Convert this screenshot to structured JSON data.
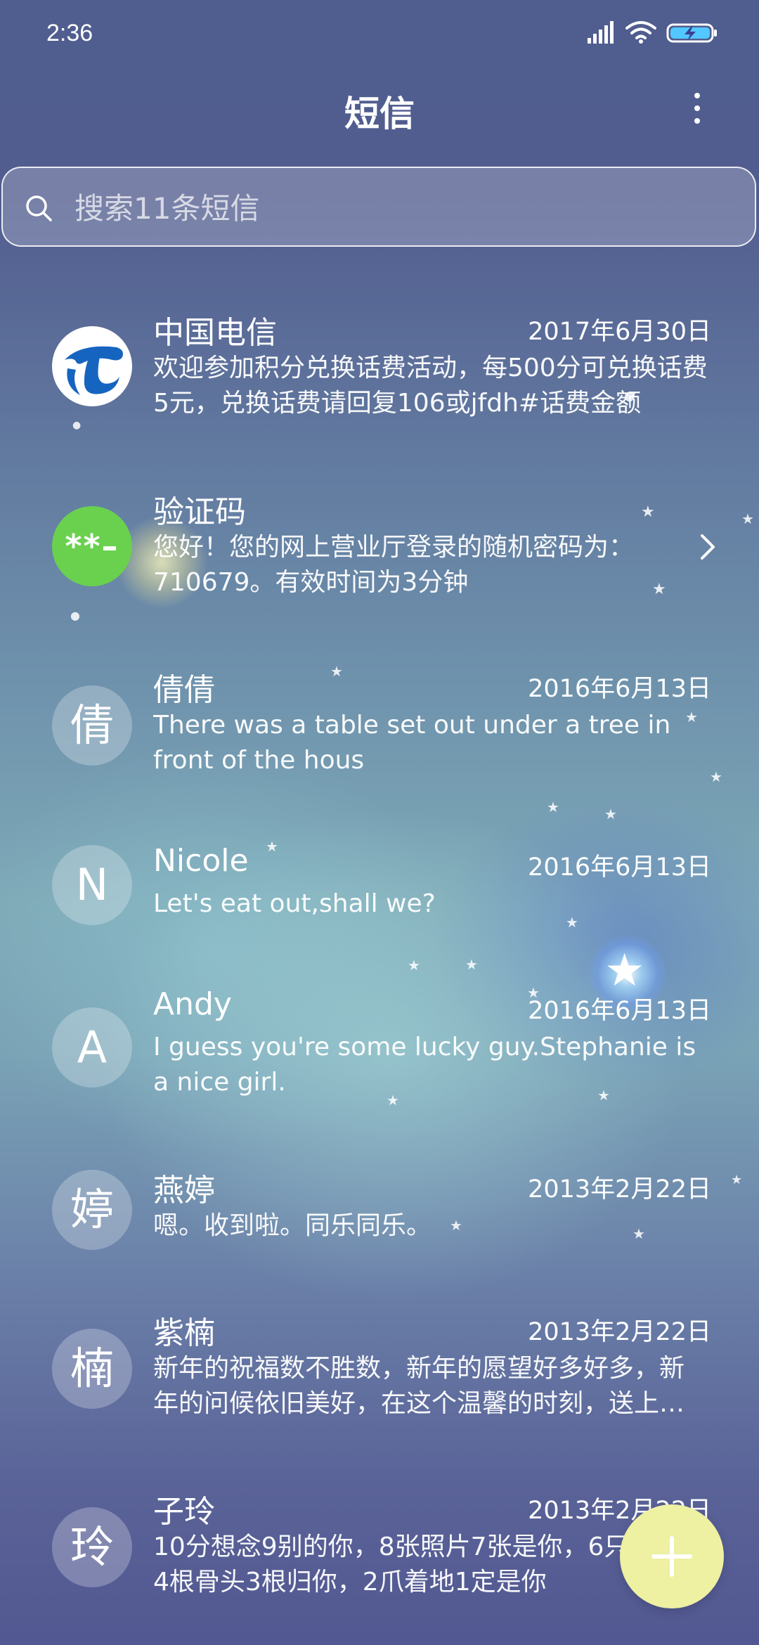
{
  "status_bar": {
    "time": "2:36"
  },
  "header": {
    "title": "短信"
  },
  "search": {
    "placeholder": "搜索11条短信"
  },
  "conversations": [
    {
      "name": "中国电信",
      "date": "2017年6月30日",
      "preview": "欢迎参加积分兑换话费活动，每500分可兑换话费5元，兑换话费请回复106或jfdh#话费金额",
      "avatar": "",
      "avatar_icon": "china-telecom-logo-icon"
    },
    {
      "name": "验证码",
      "date": "",
      "preview": "您好！您的网上营业厅登录的随机密码为：710679。有效时间为3分钟",
      "avatar": "**–",
      "avatar_icon": "verification-code-icon"
    },
    {
      "name": "倩倩",
      "date": "2016年6月13日",
      "preview": "There was a table set out under a tree in front of the hous",
      "avatar": "倩"
    },
    {
      "name": "Nicole",
      "date": "2016年6月13日",
      "preview": "Let's eat out,shall we?",
      "avatar": "N"
    },
    {
      "name": "Andy",
      "date": "2016年6月13日",
      "preview": "I guess you're some lucky guy.Stephanie is a nice girl.",
      "avatar": "A"
    },
    {
      "name": "燕婷",
      "date": "2013年2月22日",
      "preview": "嗯。收到啦。同乐同乐。",
      "avatar": "婷"
    },
    {
      "name": "紫楠",
      "date": "2013年2月22日",
      "preview": "新年的祝福数不胜数，新年的愿望好多好多，新年的问候依旧美好，在这个温馨的时刻，送上我的祝福",
      "avatar": "楠"
    },
    {
      "name": "子玲",
      "date": "2013年2月22日",
      "preview": "10分想念9别的你，8张照片7张是你，6只像你，4根骨头3根归你，2爪着地1定是你",
      "avatar": "玲"
    }
  ],
  "colors": {
    "accent_green": "#6ad14f",
    "fab": "#eef0a2",
    "telecom_blue": "#1565c0",
    "battery": "#53c7ff"
  }
}
